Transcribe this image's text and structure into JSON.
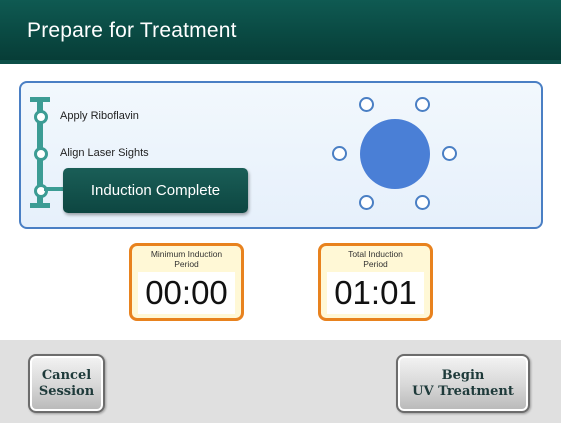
{
  "header": {
    "title": "Prepare for Treatment"
  },
  "steps": [
    {
      "label": "Apply Riboflavin"
    },
    {
      "label": "Align Laser Sights"
    },
    {
      "label": "Induction Complete"
    }
  ],
  "timers": {
    "minimum": {
      "caption_line1": "Minimum Induction",
      "caption_line2": "Period",
      "value": "00:00"
    },
    "total": {
      "caption_line1": "Total Induction",
      "caption_line2": "Period",
      "value": "01:01"
    }
  },
  "footer": {
    "cancel": {
      "line1": "Cancel",
      "line2": "Session"
    },
    "begin": {
      "line1": "Begin",
      "line2": "UV Treatment"
    }
  },
  "colors": {
    "header_bg": "#0a4a43",
    "track": "#3c9c94",
    "panel_border": "#4a7fc4",
    "eye_circle": "#4a7fd6",
    "timer_border": "#e8821e",
    "timer_bg": "#fff8d6"
  }
}
